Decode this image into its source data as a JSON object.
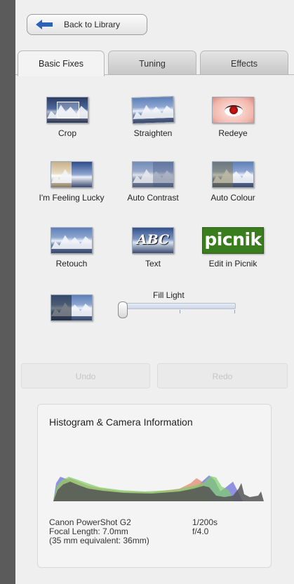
{
  "back_button": {
    "label": "Back to Library"
  },
  "tabs": [
    {
      "label": "Basic Fixes",
      "active": true
    },
    {
      "label": "Tuning",
      "active": false
    },
    {
      "label": "Effects",
      "active": false
    }
  ],
  "tools": [
    {
      "label": "Crop",
      "icon": "crop-icon"
    },
    {
      "label": "Straighten",
      "icon": "straighten-icon"
    },
    {
      "label": "Redeye",
      "icon": "redeye-icon"
    },
    {
      "label": "I'm Feeling Lucky",
      "icon": "feeling-lucky-icon"
    },
    {
      "label": "Auto Contrast",
      "icon": "auto-contrast-icon"
    },
    {
      "label": "Auto Colour",
      "icon": "auto-colour-icon"
    },
    {
      "label": "Retouch",
      "icon": "retouch-icon"
    },
    {
      "label": "Text",
      "icon": "text-icon"
    },
    {
      "label": "Edit in Picnik",
      "icon": "picnik-logo-icon"
    }
  ],
  "picnik_logo_text": "picnik",
  "text_thumb_text": "ABC",
  "fill_light": {
    "label": "Fill Light",
    "value": 0
  },
  "undo_label": "Undo",
  "redo_label": "Redo",
  "histogram": {
    "title": "Histogram & Camera Information",
    "camera": "Canon PowerShot G2",
    "focal_length": "Focal Length: 7.0mm",
    "equivalent": "(35 mm equivalent:  36mm)",
    "shutter": "1/200s",
    "aperture": "f/4.0"
  },
  "colors": {
    "sidebar_bg": "#5b5b5b",
    "panel_bg": "#efefef",
    "accent_arrow": "#2c63b8",
    "picnik_green": "#3a7d1f"
  }
}
